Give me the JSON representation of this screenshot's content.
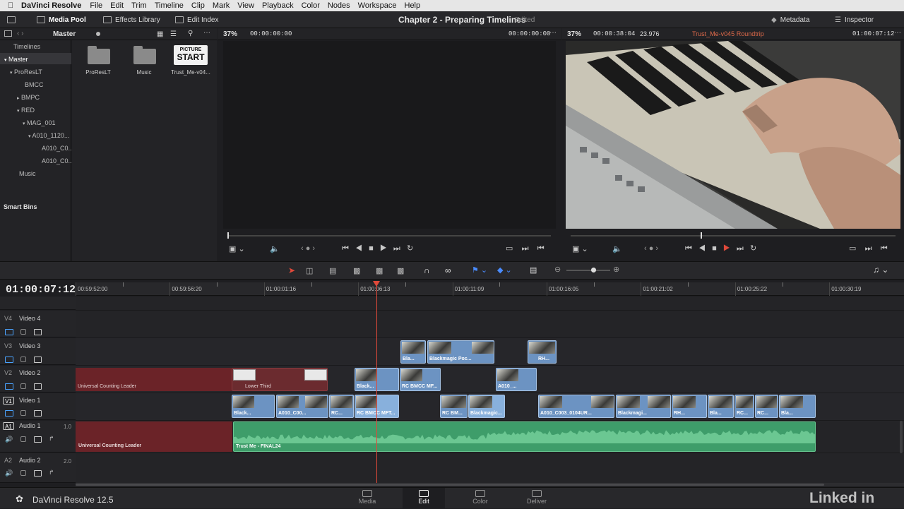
{
  "menubar": {
    "app_name": "DaVinci Resolve",
    "items": [
      "File",
      "Edit",
      "Trim",
      "Timeline",
      "Clip",
      "Mark",
      "View",
      "Playback",
      "Color",
      "Nodes",
      "Workspace",
      "Help"
    ]
  },
  "toolbar": {
    "media_pool": "Media Pool",
    "effects_library": "Effects Library",
    "edit_index": "Edit Index",
    "project_title": "Chapter 2 - Preparing Timelines",
    "edited": "Edited",
    "metadata": "Metadata",
    "inspector": "Inspector"
  },
  "media_pool": {
    "bin_header": "Master",
    "timelines_label": "Timelines",
    "tree": [
      {
        "label": "Master",
        "level": 0
      },
      {
        "label": "ProResLT",
        "level": 1
      },
      {
        "label": "BMCC",
        "level": 2
      },
      {
        "label": "BMPC",
        "level": 1
      },
      {
        "label": "RED",
        "level": 1
      },
      {
        "label": "MAG_001",
        "level": 2
      },
      {
        "label": "A010_1120...",
        "level": 3
      },
      {
        "label": "A010_C0...",
        "level": 4
      },
      {
        "label": "A010_C0...",
        "level": 4
      },
      {
        "label": "Music",
        "level": 1
      }
    ],
    "smart_bins": "Smart Bins",
    "thumbs": [
      {
        "label": "ProResLT",
        "kind": "folder"
      },
      {
        "label": "Music",
        "kind": "folder"
      },
      {
        "label": "Trust_Me-v04...",
        "kind": "timeline",
        "slate_line1": "PICTURE",
        "slate_line2": "START"
      }
    ]
  },
  "source_viewer": {
    "zoom": "37%",
    "timecode_left": "00:00:00:00",
    "timecode_right": "00:00:00:00"
  },
  "timeline_viewer": {
    "zoom": "37%",
    "duration": "00:00:38:04",
    "fps": "23.976",
    "timeline_name": "Trust_Me-v045 Roundtrip",
    "timecode": "01:00:07:12",
    "playhead_fraction": 0.4
  },
  "timeline": {
    "current_timecode": "01:00:07:12",
    "ruler": [
      "00:59:52:00",
      "00:59:56:20",
      "01:00:01:16",
      "01:00:06:13",
      "01:00:11:09",
      "01:00:16:05",
      "01:00:21:02",
      "01:00:25:22",
      "01:00:30:19"
    ],
    "tracks": [
      {
        "id": "V4",
        "name": "Video 4"
      },
      {
        "id": "V3",
        "name": "Video 3"
      },
      {
        "id": "V2",
        "name": "Video 2"
      },
      {
        "id": "V1",
        "name": "Video 1"
      },
      {
        "id": "A1",
        "name": "Audio 1",
        "level": "1.0"
      },
      {
        "id": "A2",
        "name": "Audio 2",
        "level": "2.0"
      }
    ],
    "clips": {
      "v3": [
        "Bla...",
        "Blackmagic Poc...",
        "RH..."
      ],
      "v2": [
        "Universal Counting Leader",
        "Lower Third",
        "Black...",
        "RC BMCC MF...",
        "A010_..."
      ],
      "v1": [
        "Black...",
        "A010_C00...",
        "RC...",
        "RC BMCC MFT...",
        "RC BM...",
        "Blackmagic...",
        "A010_C003_0104UR...",
        "Blackmagi...",
        "RH...",
        "Bla...",
        "RC...",
        "RC...",
        "Bla..."
      ],
      "a1": [
        "Universal Counting Leader",
        "Trust Me - FINAL24"
      ]
    }
  },
  "footer": {
    "app_version": "DaVinci Resolve 12.5",
    "pages": [
      "Media",
      "Edit",
      "Color",
      "Deliver"
    ],
    "active_page": "Edit",
    "watermark": "Linked in"
  },
  "colors": {
    "video_clip": "#6c93c2",
    "audio_clip": "#3e9d6a",
    "leader": "#6b2328",
    "playhead": "#e0493a"
  }
}
